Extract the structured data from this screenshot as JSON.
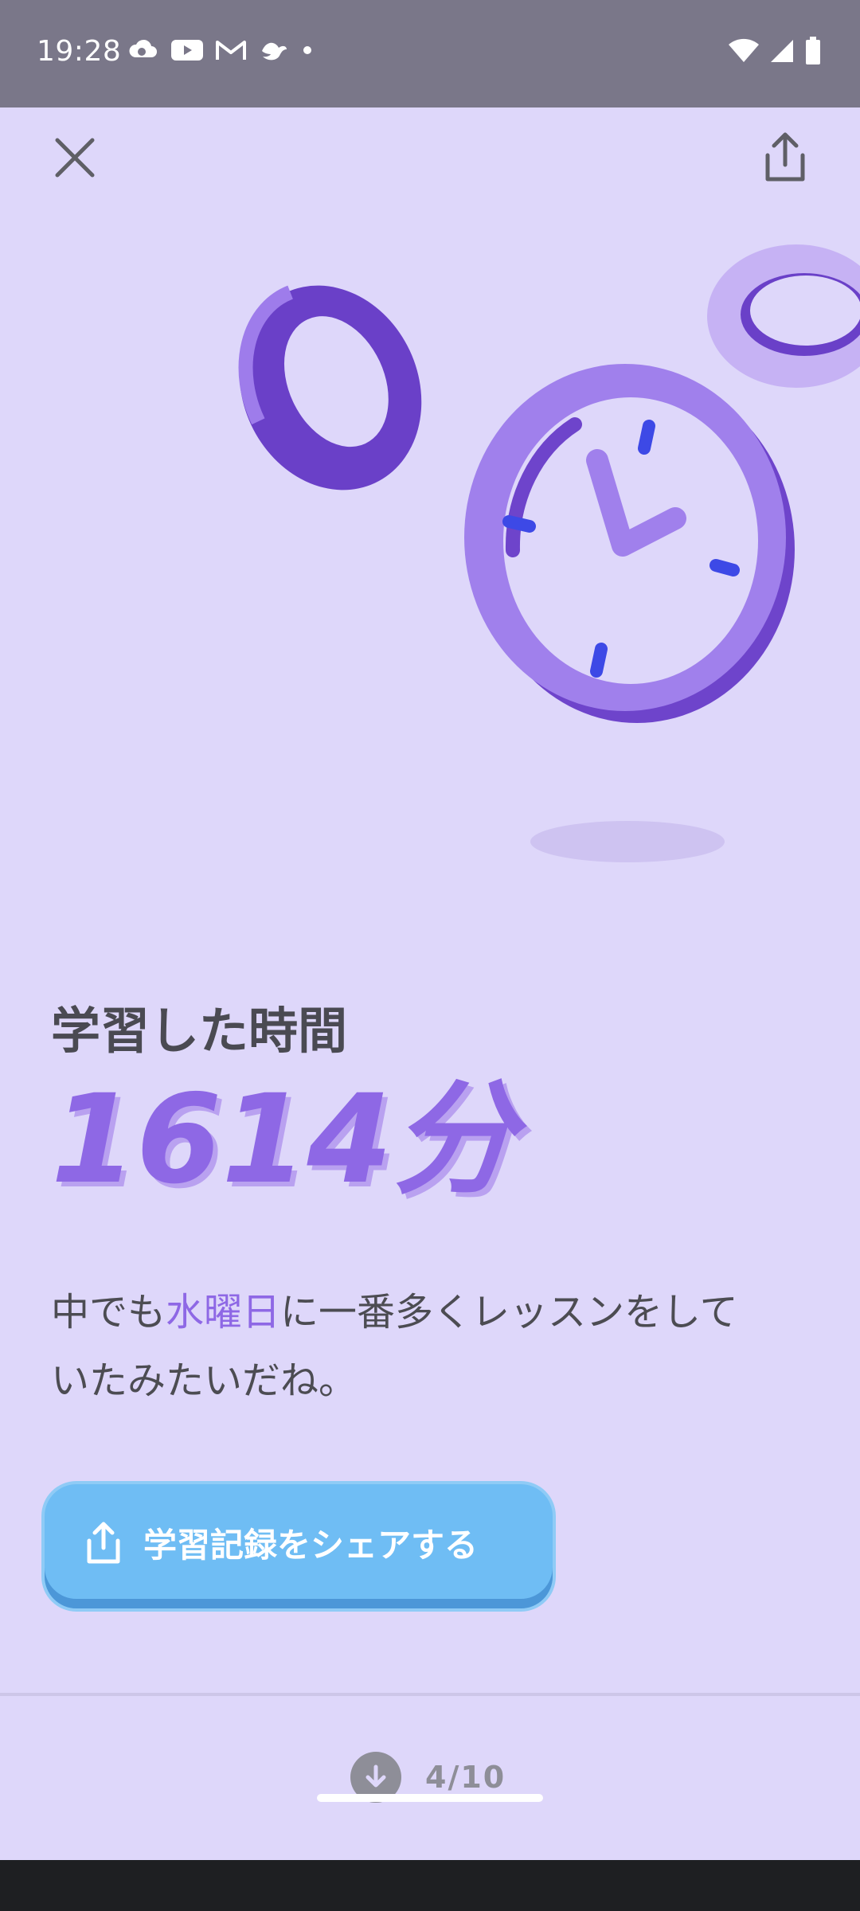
{
  "status_bar": {
    "time": "19:28",
    "left_icons": [
      "cloud-icon",
      "youtube-icon",
      "gmail-icon",
      "bird-icon",
      "dot-icon"
    ],
    "right_icons": [
      "wifi-icon",
      "signal-icon",
      "battery-icon"
    ]
  },
  "header": {
    "close_icon": "close-icon",
    "share_icon": "share-icon"
  },
  "hero": {
    "illustration": "clock-illustration"
  },
  "content": {
    "title": "学習した時間",
    "minutes": "1614分",
    "description_before": "中でも",
    "description_highlight": "水曜日",
    "description_after": "に一番多くレッスンをしていたみたいだね。"
  },
  "share_button": {
    "label": "学習記録をシェアする",
    "icon": "share-icon"
  },
  "pager": {
    "icon": "arrow-down-icon",
    "indicator": "4/10"
  },
  "colors": {
    "background": "#DED7FA",
    "accent_purple": "#8E68E5",
    "share_blue": "#6FBDF4",
    "text_dark": "#4A4A52"
  }
}
